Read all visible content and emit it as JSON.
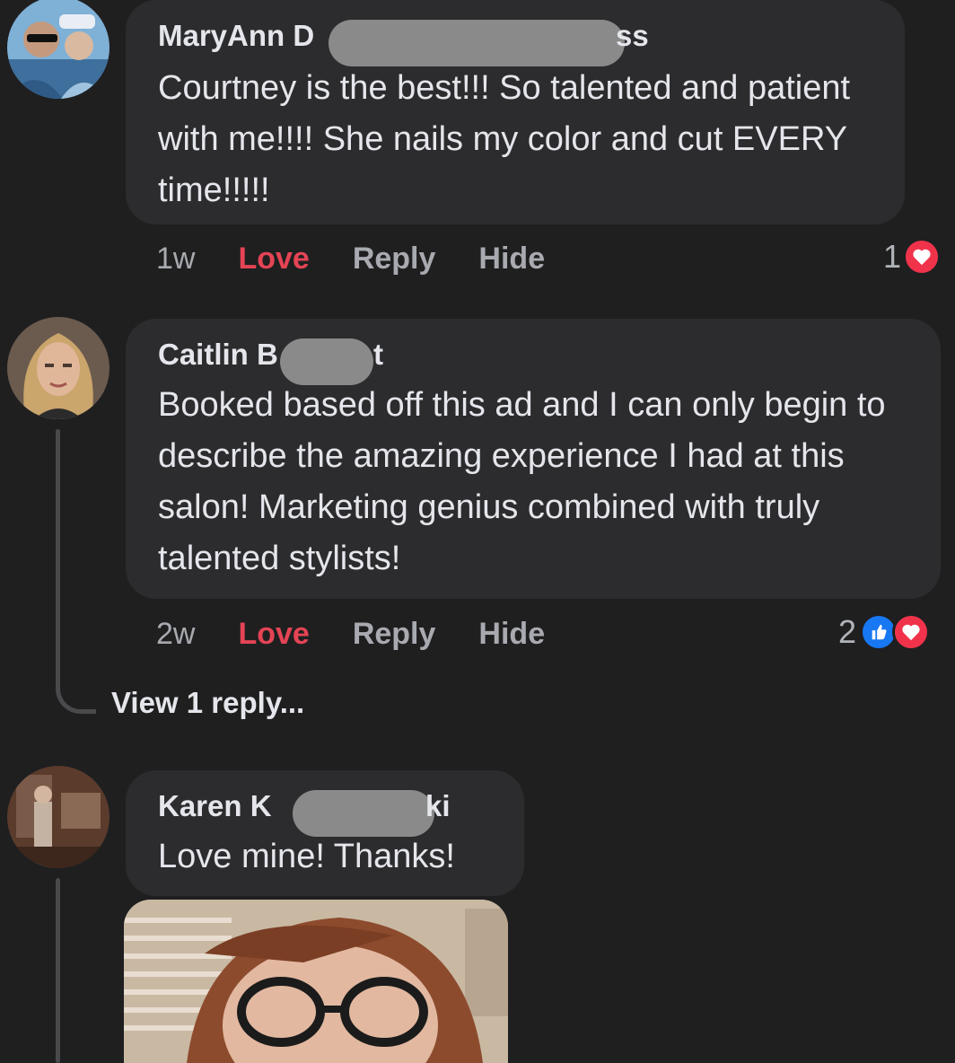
{
  "comments": [
    {
      "author_prefix": "MaryAnn D",
      "author_suffix": "ss",
      "text": "Courtney is the best!!! So talented and patient with me!!!! She nails my color and cut EVERY time!!!!!",
      "time": "1w",
      "love_label": "Love",
      "reply_label": "Reply",
      "hide_label": "Hide",
      "reaction_count": "1",
      "reaction_icons": [
        "heart-icon"
      ]
    },
    {
      "author_prefix": "Caitlin B",
      "author_suffix": "t",
      "text": "Booked based off this ad and I can only begin to describe the amazing experience I had at this salon! Marketing genius combined with truly talented stylists!",
      "time": "2w",
      "love_label": "Love",
      "reply_label": "Reply",
      "hide_label": "Hide",
      "reaction_count": "2",
      "reaction_icons": [
        "like-icon",
        "heart-icon"
      ],
      "view_replies_label": "View 1 reply..."
    },
    {
      "author_prefix": "Karen K",
      "author_suffix": "ki",
      "text": "Love mine! Thanks!"
    }
  ],
  "colors": {
    "background": "#1f1f20",
    "bubble": "#2c2c2e",
    "love": "#e44454",
    "heart": "#f0334b",
    "like": "#1877f2"
  }
}
